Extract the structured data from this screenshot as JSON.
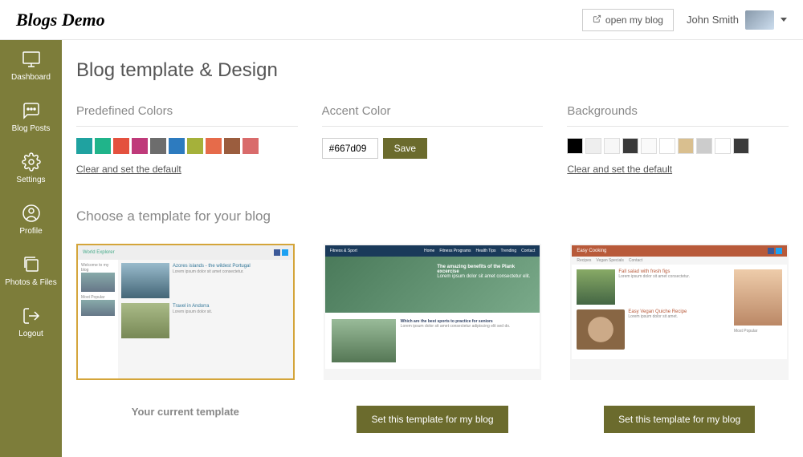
{
  "header": {
    "logo": "Blogs Demo",
    "open_blog": "open my blog",
    "user_name": "John Smith"
  },
  "sidebar": {
    "items": [
      {
        "id": "dashboard",
        "label": "Dashboard",
        "icon": "monitor"
      },
      {
        "id": "blog-posts",
        "label": "Blog Posts",
        "icon": "chat"
      },
      {
        "id": "settings",
        "label": "Settings",
        "icon": "gear"
      },
      {
        "id": "profile",
        "label": "Profile",
        "icon": "user"
      },
      {
        "id": "photos-files",
        "label": "Photos & Files",
        "icon": "stack"
      },
      {
        "id": "logout",
        "label": "Logout",
        "icon": "exit"
      }
    ]
  },
  "page": {
    "title": "Blog template & Design",
    "predefined": {
      "heading": "Predefined Colors",
      "colors": [
        "#1fa2a0",
        "#20b48a",
        "#e4513e",
        "#bf3a7a",
        "#6d6d6d",
        "#2d7bbf",
        "#a5b13a",
        "#e66b4a",
        "#9b5d3e",
        "#d96b6b"
      ],
      "clear": "Clear and set the default"
    },
    "accent": {
      "heading": "Accent Color",
      "value": "#667d09",
      "save": "Save"
    },
    "backgrounds": {
      "heading": "Backgrounds",
      "swatches": [
        "#000000",
        "#eeeeee",
        "#f7f7f7",
        "#3a3a3a",
        "#fafafa",
        "#ffffff",
        "#d9bf8f",
        "#cccccc",
        "#ffffff",
        "#3a3a3a"
      ],
      "clear": "Clear and set the default"
    },
    "templates": {
      "heading": "Choose a template for your blog",
      "current_caption": "Your current template",
      "set_button": "Set this template for my blog",
      "items": [
        {
          "id": "world-explorer",
          "title": "World Explorer",
          "current": true
        },
        {
          "id": "fitness-sport",
          "title": "Fitness & Sport",
          "current": false
        },
        {
          "id": "easy-cooking",
          "title": "Easy Cooking",
          "current": false
        }
      ]
    }
  }
}
